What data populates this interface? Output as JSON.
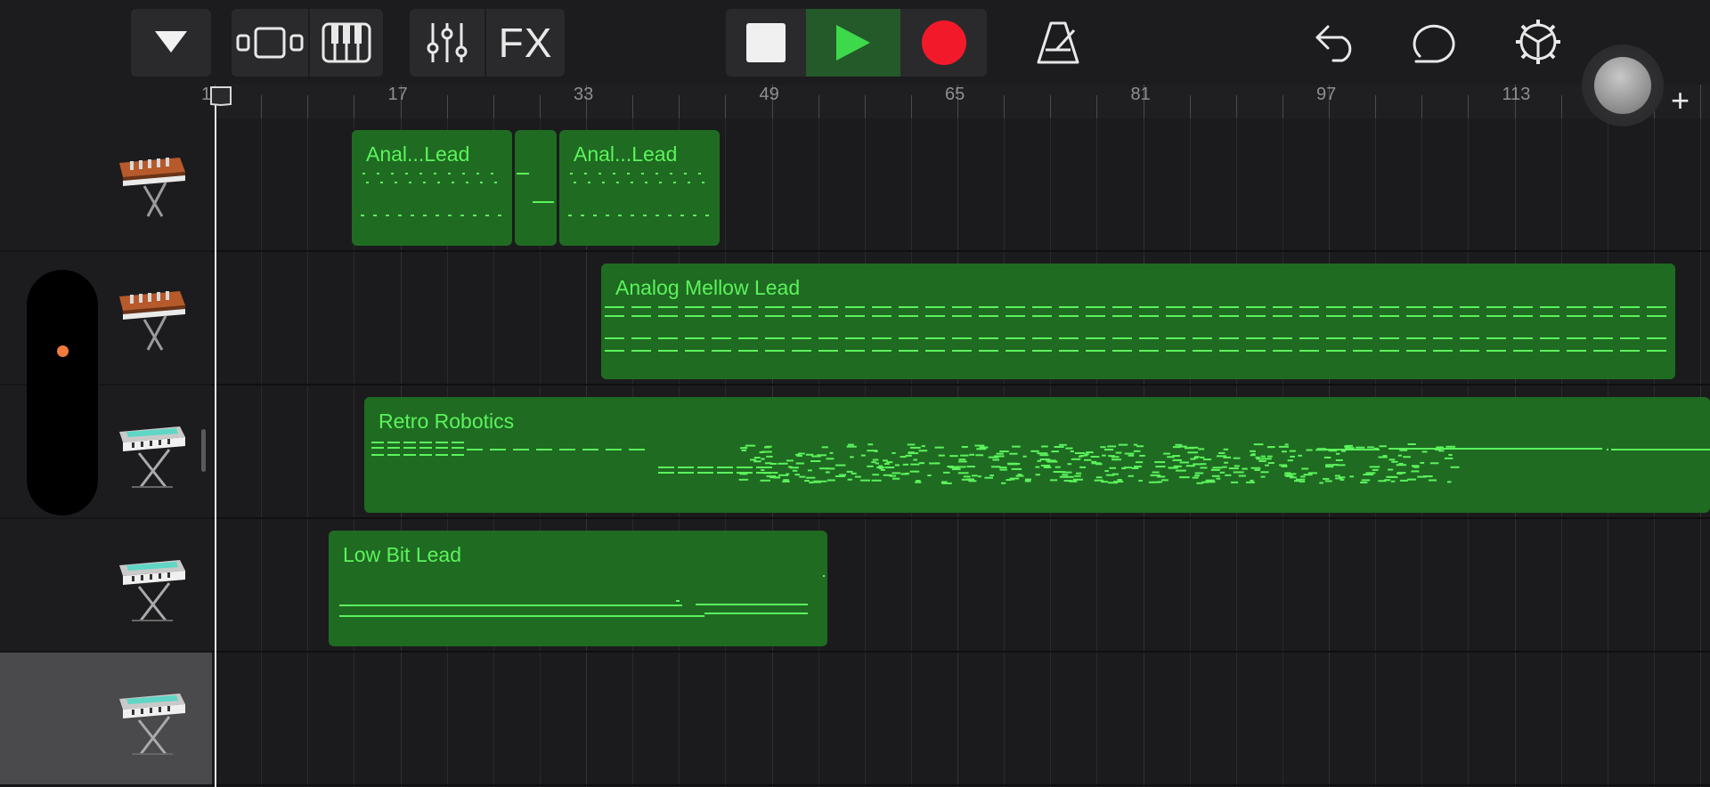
{
  "toolbar": {
    "icons": [
      "browser-toggle-icon",
      "tracks-view-icon",
      "keyboard-icon",
      "mixer-icon",
      "stop-icon",
      "play-icon",
      "record-icon",
      "metronome-icon",
      "undo-icon",
      "loop-icon",
      "settings-icon"
    ],
    "fx_label": "FX",
    "colors": {
      "play": "#3dd94a",
      "record": "#f21a2a",
      "play_bg": "#24592a"
    }
  },
  "ruler": {
    "bars": [
      "1",
      "17",
      "33",
      "49",
      "65",
      "81",
      "97",
      "113"
    ]
  },
  "tracks": [
    {
      "instrument_icon": "analog-synth-icon",
      "selected": false
    },
    {
      "instrument_icon": "analog-synth-icon",
      "selected": false
    },
    {
      "instrument_icon": "keyboard-synth-icon",
      "selected": false
    },
    {
      "instrument_icon": "keyboard-synth-icon",
      "selected": false
    },
    {
      "instrument_icon": "keyboard-synth-icon",
      "selected": true
    }
  ],
  "regions": [
    {
      "track": 0,
      "name": "Anal...Lead"
    },
    {
      "track": 0,
      "name": ""
    },
    {
      "track": 0,
      "name": "Anal...Lead"
    },
    {
      "track": 1,
      "name": "Analog Mellow Lead"
    },
    {
      "track": 2,
      "name": "Retro Robotics"
    },
    {
      "track": 3,
      "name": "Low Bit Lead"
    }
  ],
  "add_track_label": "+",
  "colors": {
    "region_fill": "#1f6b22",
    "region_text": "#5cf35c",
    "note": "#5cf35c"
  }
}
